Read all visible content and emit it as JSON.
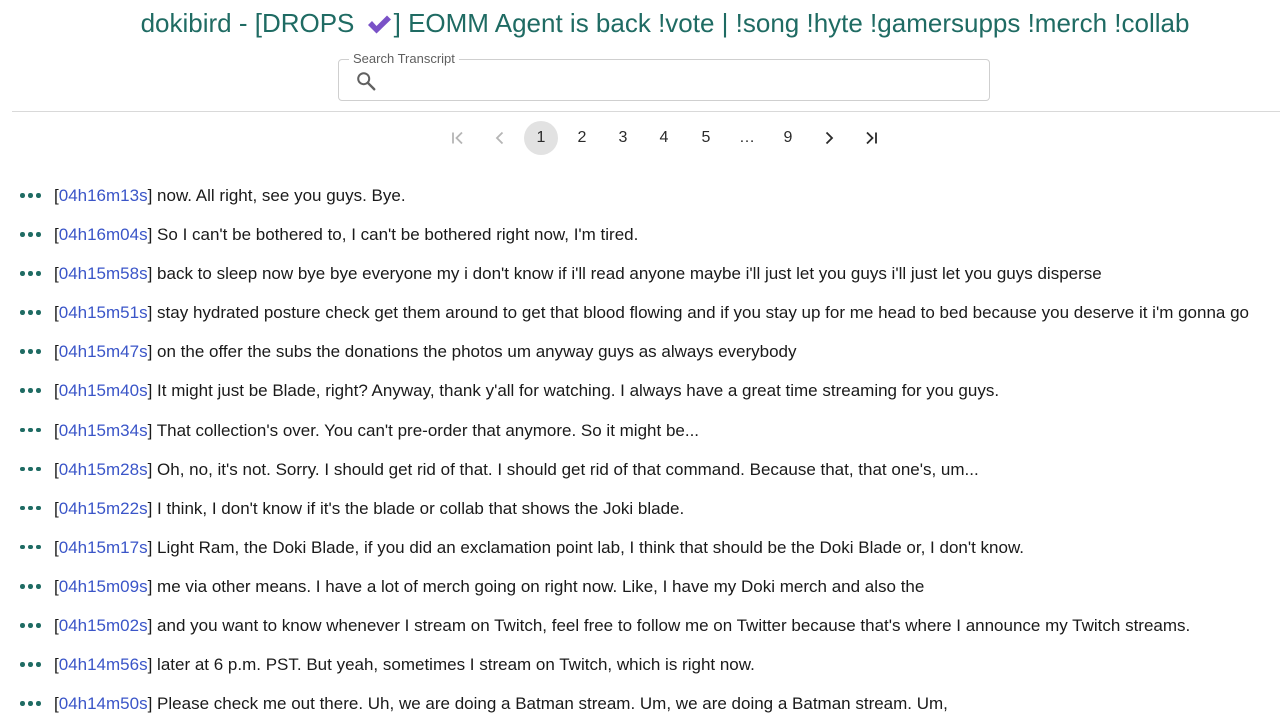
{
  "page": {
    "title_before": "dokibird - [DROPS",
    "title_after": "] EOMM Agent is back !vote | !song !hyte !gamersupps !merch !collab",
    "check_icon": "heavy-check-mark-icon",
    "check_color": "#7a52c7",
    "accent_color": "#1f6b63"
  },
  "search": {
    "label": "Search Transcript",
    "placeholder": "",
    "value": "",
    "icon": "search-icon"
  },
  "pagination": {
    "current": "1",
    "pages": [
      "1",
      "2",
      "3",
      "4",
      "5",
      "…",
      "9"
    ],
    "first_icon": "first-page-icon",
    "prev_icon": "chevron-left-icon",
    "next_icon": "chevron-right-icon",
    "last_icon": "last-page-icon"
  },
  "transcript": {
    "menu_icon": "more-horizontal-icon",
    "timestamp_color": "#3a55c8",
    "lines": [
      {
        "ts": "04h16m13s",
        "text": "now. All right, see you guys. Bye."
      },
      {
        "ts": "04h16m04s",
        "text": "So I can't be bothered to, I can't be bothered right now, I'm tired."
      },
      {
        "ts": "04h15m58s",
        "text": "back to sleep now bye bye everyone my i don't know if i'll read anyone maybe i'll just let you guys i'll just let you guys disperse"
      },
      {
        "ts": "04h15m51s",
        "text": "stay hydrated posture check get them around to get that blood flowing and if you stay up for me head to bed because you deserve it i'm gonna go"
      },
      {
        "ts": "04h15m47s",
        "text": "on the offer the subs the donations the photos um anyway guys as always everybody"
      },
      {
        "ts": "04h15m40s",
        "text": "It might just be Blade, right? Anyway, thank y'all for watching. I always have a great time streaming for you guys."
      },
      {
        "ts": "04h15m34s",
        "text": "That collection's over. You can't pre-order that anymore. So it might be..."
      },
      {
        "ts": "04h15m28s",
        "text": "Oh, no, it's not. Sorry. I should get rid of that. I should get rid of that command. Because that, that one's, um..."
      },
      {
        "ts": "04h15m22s",
        "text": "I think, I don't know if it's the blade or collab that shows the Joki blade."
      },
      {
        "ts": "04h15m17s",
        "text": "Light Ram, the Doki Blade, if you did an exclamation point lab, I think that should be the Doki Blade or, I don't know."
      },
      {
        "ts": "04h15m09s",
        "text": "me via other means. I have a lot of merch going on right now. Like, I have my Doki merch and also the"
      },
      {
        "ts": "04h15m02s",
        "text": "and you want to know whenever I stream on Twitch, feel free to follow me on Twitter because that's where I announce my Twitch streams."
      },
      {
        "ts": "04h14m56s",
        "text": "later at 6 p.m. PST. But yeah, sometimes I stream on Twitch, which is right now."
      },
      {
        "ts": "04h14m50s",
        "text": "Please check me out there. Uh, we are doing a Batman stream. Um, we are doing a Batman stream. Um,"
      }
    ]
  }
}
